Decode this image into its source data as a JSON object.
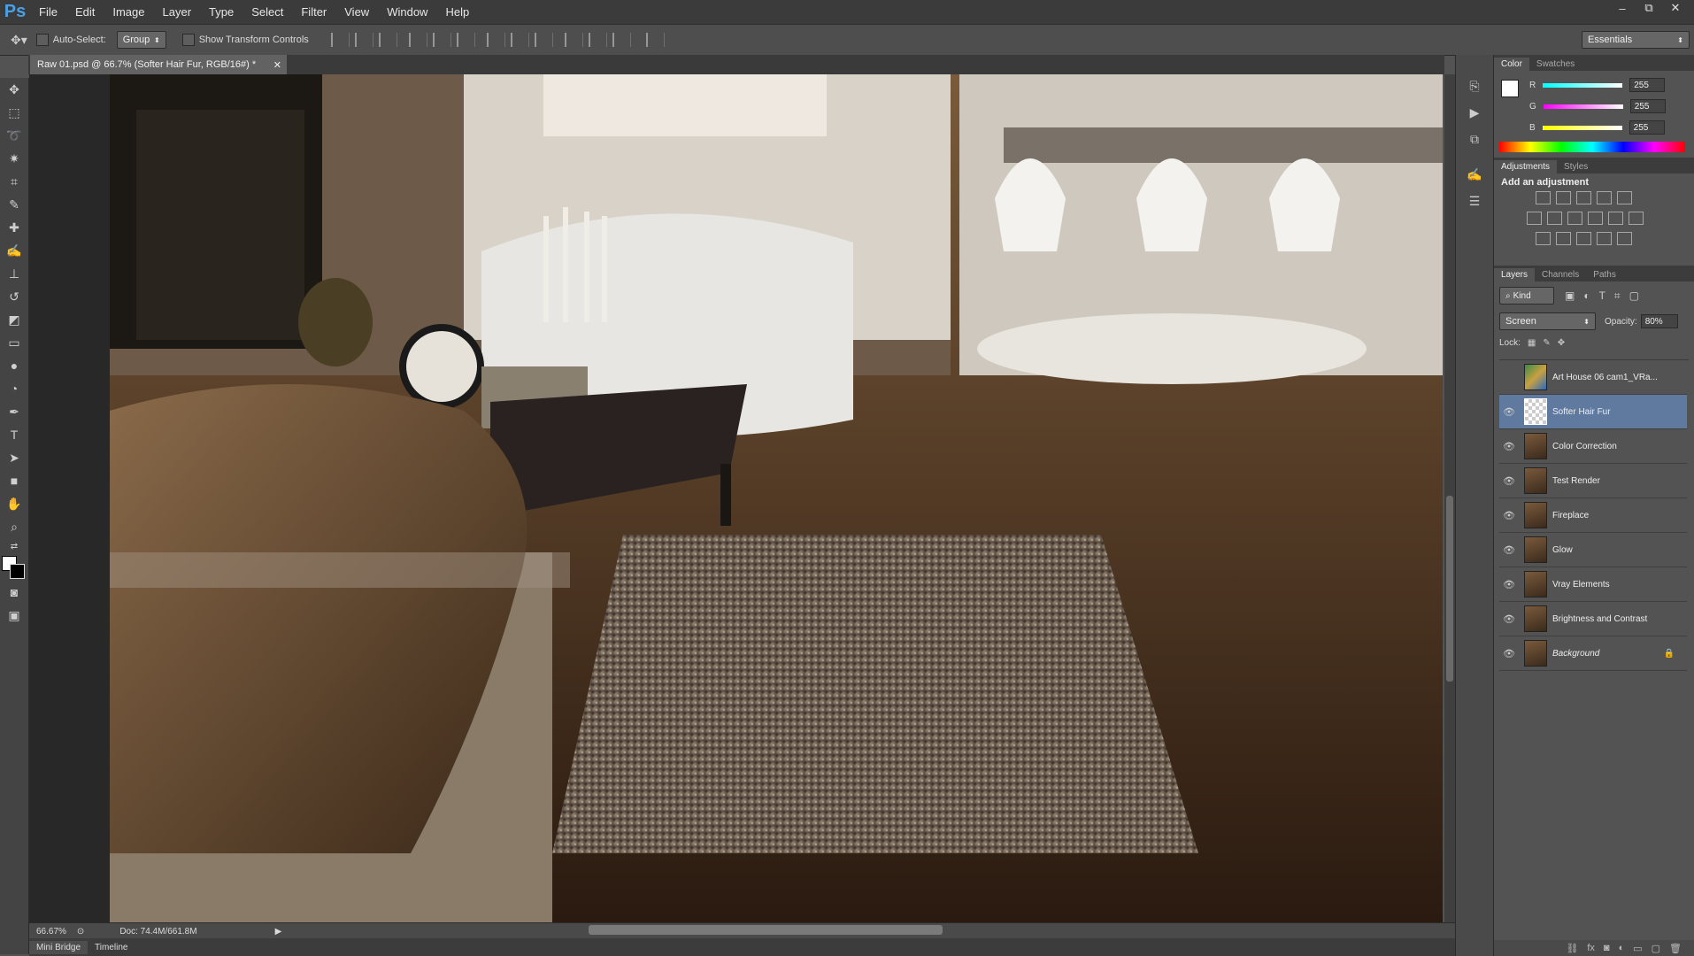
{
  "app": {
    "logo": "Ps"
  },
  "menu": [
    "File",
    "Edit",
    "Image",
    "Layer",
    "Type",
    "Select",
    "Filter",
    "View",
    "Window",
    "Help"
  ],
  "window_controls": {
    "minimize": "–",
    "restore": "⧉",
    "close": "✕"
  },
  "options_bar": {
    "auto_select_label": "Auto-Select:",
    "auto_select_value": "Group",
    "show_transform_label": "Show Transform Controls",
    "workspace": "Essentials"
  },
  "document": {
    "tab_title": "Raw 01.psd @ 66.7% (Softer Hair Fur, RGB/16#) *",
    "zoom": "66.67%",
    "doc_size": "Doc: 74.4M/661.8M"
  },
  "bottom_tabs": [
    "Mini Bridge",
    "Timeline"
  ],
  "color_panel": {
    "tabs": [
      "Color",
      "Swatches"
    ],
    "channels": [
      {
        "label": "R",
        "value": "255"
      },
      {
        "label": "G",
        "value": "255"
      },
      {
        "label": "B",
        "value": "255"
      }
    ]
  },
  "adjustments_panel": {
    "tabs": [
      "Adjustments",
      "Styles"
    ],
    "heading": "Add an adjustment"
  },
  "layers_panel": {
    "tabs": [
      "Layers",
      "Channels",
      "Paths"
    ],
    "filter": "Kind",
    "blend_mode": "Screen",
    "opacity_label": "Opacity:",
    "opacity_value": "80%",
    "lock_label": "Lock:",
    "layers": [
      {
        "name": "Art House 06 cam1_VRa...",
        "visible": false,
        "selected": false
      },
      {
        "name": "Softer Hair Fur",
        "visible": true,
        "selected": true
      },
      {
        "name": "Color Correction",
        "visible": true,
        "selected": false
      },
      {
        "name": "Test Render",
        "visible": true,
        "selected": false
      },
      {
        "name": "Fireplace",
        "visible": true,
        "selected": false
      },
      {
        "name": "Glow",
        "visible": true,
        "selected": false
      },
      {
        "name": "Vray Elements",
        "visible": true,
        "selected": false
      },
      {
        "name": "Brightness and Contrast",
        "visible": true,
        "selected": false
      },
      {
        "name": "Background",
        "visible": true,
        "selected": false
      }
    ]
  }
}
